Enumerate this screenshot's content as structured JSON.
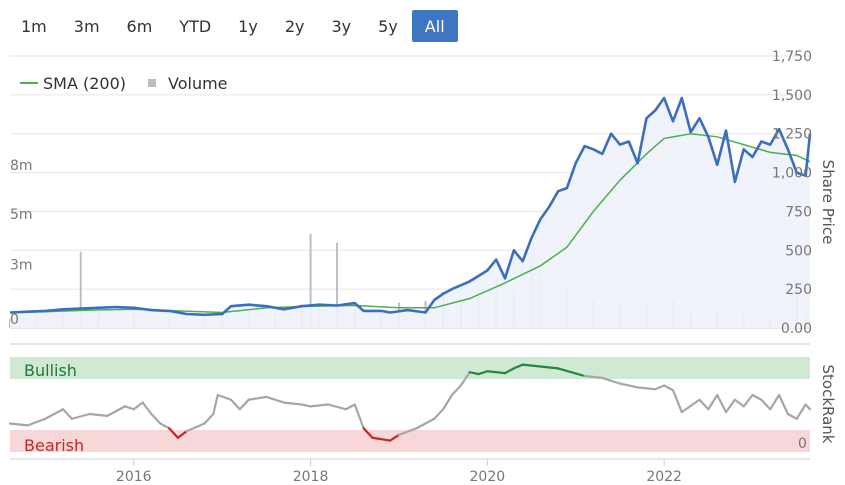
{
  "range_buttons": [
    {
      "label": "1m",
      "active": false
    },
    {
      "label": "3m",
      "active": false
    },
    {
      "label": "6m",
      "active": false
    },
    {
      "label": "YTD",
      "active": false
    },
    {
      "label": "1y",
      "active": false
    },
    {
      "label": "2y",
      "active": false
    },
    {
      "label": "3y",
      "active": false
    },
    {
      "label": "5y",
      "active": false
    },
    {
      "label": "All",
      "active": true
    }
  ],
  "colors": {
    "price_line": "#3b6fbd",
    "price_fill": "#eef2fa",
    "sma_line": "#4caf50",
    "volume_bar": "#bdbdbd",
    "rank_neutral": "#a6a6a6",
    "rank_bullish": "#1e8a3a",
    "rank_bearish": "#c62828",
    "bullish_band": "#cfe9d5",
    "bearish_band": "#f7d7d8",
    "active_button": "#3f76c4"
  },
  "chart_data": [
    {
      "type": "line",
      "legend": {
        "items": [
          "SMA (200)",
          "Volume"
        ],
        "placement": "top-left"
      },
      "y_right": {
        "title": "Share Price",
        "ticks": [
          "0.00",
          "250",
          "500",
          "750",
          "1,000",
          "1,250",
          "1,500",
          "1,750"
        ],
        "range": [
          0,
          1750
        ]
      },
      "y_left": {
        "ticks": [
          "0",
          "3m",
          "5m",
          "8m"
        ],
        "range": [
          0,
          15000000
        ]
      },
      "x": {
        "ticks": [
          "2016",
          "2018",
          "2020",
          "2022"
        ],
        "range": [
          2014.6,
          2023.65
        ]
      },
      "series": [
        {
          "name": "Share Price",
          "points": [
            [
              2014.6,
              100
            ],
            [
              2014.8,
              105
            ],
            [
              2015.0,
              110
            ],
            [
              2015.2,
              120
            ],
            [
              2015.4,
              125
            ],
            [
              2015.6,
              130
            ],
            [
              2015.8,
              135
            ],
            [
              2016.0,
              130
            ],
            [
              2016.2,
              115
            ],
            [
              2016.4,
              110
            ],
            [
              2016.6,
              90
            ],
            [
              2016.8,
              85
            ],
            [
              2017.0,
              90
            ],
            [
              2017.1,
              140
            ],
            [
              2017.3,
              150
            ],
            [
              2017.5,
              140
            ],
            [
              2017.7,
              120
            ],
            [
              2017.9,
              140
            ],
            [
              2018.1,
              150
            ],
            [
              2018.3,
              145
            ],
            [
              2018.5,
              160
            ],
            [
              2018.6,
              110
            ],
            [
              2018.8,
              110
            ],
            [
              2018.9,
              100
            ],
            [
              2019.1,
              115
            ],
            [
              2019.3,
              100
            ],
            [
              2019.4,
              180
            ],
            [
              2019.5,
              220
            ],
            [
              2019.6,
              250
            ],
            [
              2019.8,
              300
            ],
            [
              2020.0,
              370
            ],
            [
              2020.1,
              440
            ],
            [
              2020.2,
              320
            ],
            [
              2020.3,
              500
            ],
            [
              2020.4,
              430
            ],
            [
              2020.5,
              580
            ],
            [
              2020.6,
              700
            ],
            [
              2020.7,
              780
            ],
            [
              2020.8,
              880
            ],
            [
              2020.9,
              900
            ],
            [
              2021.0,
              1060
            ],
            [
              2021.1,
              1170
            ],
            [
              2021.2,
              1150
            ],
            [
              2021.3,
              1120
            ],
            [
              2021.4,
              1250
            ],
            [
              2021.5,
              1180
            ],
            [
              2021.6,
              1200
            ],
            [
              2021.7,
              1060
            ],
            [
              2021.8,
              1350
            ],
            [
              2021.9,
              1400
            ],
            [
              2022.0,
              1480
            ],
            [
              2022.1,
              1330
            ],
            [
              2022.2,
              1480
            ],
            [
              2022.3,
              1260
            ],
            [
              2022.4,
              1350
            ],
            [
              2022.5,
              1230
            ],
            [
              2022.6,
              1050
            ],
            [
              2022.7,
              1270
            ],
            [
              2022.8,
              940
            ],
            [
              2022.9,
              1150
            ],
            [
              2023.0,
              1100
            ],
            [
              2023.1,
              1200
            ],
            [
              2023.2,
              1180
            ],
            [
              2023.3,
              1280
            ],
            [
              2023.4,
              1150
            ],
            [
              2023.5,
              1000
            ],
            [
              2023.6,
              980
            ],
            [
              2023.65,
              1250
            ]
          ]
        },
        {
          "name": "SMA (200)",
          "points": [
            [
              2014.6,
              100
            ],
            [
              2015.0,
              105
            ],
            [
              2015.5,
              115
            ],
            [
              2016.0,
              120
            ],
            [
              2016.5,
              110
            ],
            [
              2017.0,
              100
            ],
            [
              2017.5,
              130
            ],
            [
              2018.0,
              140
            ],
            [
              2018.5,
              145
            ],
            [
              2019.0,
              130
            ],
            [
              2019.4,
              130
            ],
            [
              2019.8,
              190
            ],
            [
              2020.2,
              290
            ],
            [
              2020.6,
              400
            ],
            [
              2020.9,
              520
            ],
            [
              2021.2,
              750
            ],
            [
              2021.5,
              950
            ],
            [
              2021.8,
              1120
            ],
            [
              2022.0,
              1220
            ],
            [
              2022.3,
              1250
            ],
            [
              2022.6,
              1230
            ],
            [
              2022.9,
              1180
            ],
            [
              2023.2,
              1130
            ],
            [
              2023.5,
              1110
            ],
            [
              2023.65,
              1070
            ]
          ]
        }
      ],
      "volume": [
        [
          2014.6,
          0.5
        ],
        [
          2014.9,
          0.6
        ],
        [
          2015.2,
          1.0
        ],
        [
          2015.4,
          4.2
        ],
        [
          2015.6,
          1.0
        ],
        [
          2016.0,
          0.8
        ],
        [
          2016.4,
          0.6
        ],
        [
          2016.8,
          0.5
        ],
        [
          2017.0,
          0.7
        ],
        [
          2017.3,
          1.0
        ],
        [
          2017.6,
          0.8
        ],
        [
          2017.9,
          1.3
        ],
        [
          2018.0,
          5.2
        ],
        [
          2018.1,
          1.2
        ],
        [
          2018.3,
          4.7
        ],
        [
          2018.5,
          1.0
        ],
        [
          2018.8,
          1.0
        ],
        [
          2019.0,
          1.4
        ],
        [
          2019.3,
          1.5
        ],
        [
          2019.5,
          2.0
        ],
        [
          2019.7,
          1.6
        ],
        [
          2019.9,
          2.2
        ],
        [
          2020.1,
          2.8
        ],
        [
          2020.3,
          2.0
        ],
        [
          2020.5,
          4.2
        ],
        [
          2020.6,
          3.0
        ],
        [
          2020.9,
          2.2
        ],
        [
          2021.2,
          1.6
        ],
        [
          2021.5,
          1.4
        ],
        [
          2021.8,
          1.3
        ],
        [
          2022.1,
          1.5
        ],
        [
          2022.3,
          0.8
        ],
        [
          2022.6,
          0.9
        ],
        [
          2022.9,
          0.7
        ],
        [
          2023.2,
          0.6
        ],
        [
          2023.5,
          2.8
        ],
        [
          2023.6,
          0.7
        ]
      ]
    },
    {
      "type": "line",
      "y_right": {
        "title": "StockRank",
        "ticks": [
          "0"
        ],
        "range": [
          0,
          100
        ]
      },
      "bands": [
        {
          "label": "Bullish",
          "range": [
            80,
            100
          ]
        },
        {
          "label": "Bearish",
          "range": [
            0,
            20
          ]
        }
      ],
      "series": [
        {
          "name": "StockRank",
          "points": [
            [
              2014.6,
              30
            ],
            [
              2014.8,
              28
            ],
            [
              2015.0,
              35
            ],
            [
              2015.2,
              45
            ],
            [
              2015.3,
              35
            ],
            [
              2015.5,
              40
            ],
            [
              2015.7,
              38
            ],
            [
              2015.9,
              48
            ],
            [
              2016.0,
              45
            ],
            [
              2016.1,
              52
            ],
            [
              2016.2,
              40
            ],
            [
              2016.3,
              30
            ],
            [
              2016.4,
              25
            ],
            [
              2016.5,
              15
            ],
            [
              2016.6,
              22
            ],
            [
              2016.8,
              30
            ],
            [
              2016.9,
              40
            ],
            [
              2016.95,
              60
            ],
            [
              2017.1,
              55
            ],
            [
              2017.2,
              45
            ],
            [
              2017.3,
              55
            ],
            [
              2017.5,
              58
            ],
            [
              2017.7,
              52
            ],
            [
              2017.9,
              50
            ],
            [
              2018.0,
              48
            ],
            [
              2018.2,
              50
            ],
            [
              2018.4,
              45
            ],
            [
              2018.5,
              50
            ],
            [
              2018.6,
              25
            ],
            [
              2018.7,
              15
            ],
            [
              2018.9,
              12
            ],
            [
              2019.0,
              18
            ],
            [
              2019.2,
              25
            ],
            [
              2019.4,
              35
            ],
            [
              2019.5,
              45
            ],
            [
              2019.6,
              60
            ],
            [
              2019.7,
              70
            ],
            [
              2019.8,
              84
            ],
            [
              2019.9,
              82
            ],
            [
              2020.0,
              85
            ],
            [
              2020.2,
              83
            ],
            [
              2020.3,
              88
            ],
            [
              2020.4,
              92
            ],
            [
              2020.6,
              90
            ],
            [
              2020.8,
              88
            ],
            [
              2020.95,
              84
            ],
            [
              2021.1,
              80
            ],
            [
              2021.3,
              78
            ],
            [
              2021.5,
              72
            ],
            [
              2021.7,
              68
            ],
            [
              2021.9,
              66
            ],
            [
              2022.0,
              70
            ],
            [
              2022.1,
              65
            ],
            [
              2022.2,
              42
            ],
            [
              2022.4,
              55
            ],
            [
              2022.5,
              45
            ],
            [
              2022.6,
              60
            ],
            [
              2022.7,
              42
            ],
            [
              2022.8,
              55
            ],
            [
              2022.9,
              48
            ],
            [
              2023.0,
              60
            ],
            [
              2023.1,
              55
            ],
            [
              2023.2,
              45
            ],
            [
              2023.3,
              60
            ],
            [
              2023.4,
              40
            ],
            [
              2023.5,
              35
            ],
            [
              2023.6,
              50
            ],
            [
              2023.65,
              45
            ]
          ]
        }
      ]
    }
  ],
  "labels": {
    "legend_sma": "SMA (200)",
    "legend_volume": "Volume",
    "price_axis_title": "Share Price",
    "rank_axis_title": "StockRank",
    "bullish": "Bullish",
    "bearish": "Bearish",
    "rank_zero": "0"
  }
}
